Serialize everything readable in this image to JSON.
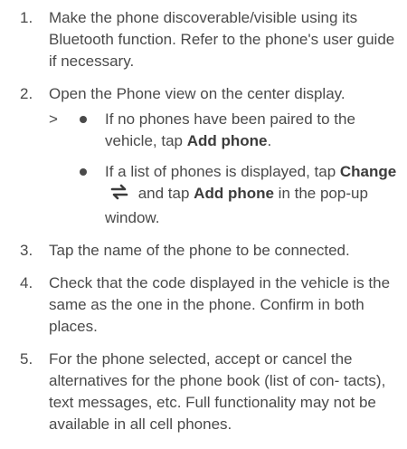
{
  "steps": [
    {
      "number": "1.",
      "text": "Make the phone discoverable/visible using its Bluetooth function. Refer to the phone's user guide if necessary."
    },
    {
      "number": "2.",
      "text": "Open the Phone view on the center display.",
      "result_marker": ">",
      "bullets": [
        {
          "pre": "If no phones have been paired to the vehicle, tap ",
          "bold": "Add phone",
          "post": "."
        },
        {
          "pre": "If a list of phones is displayed, tap ",
          "bold1": "Change",
          "icon": "change-arrows-icon",
          "mid": " and tap ",
          "bold2": "Add phone",
          "post": " in the pop-up window."
        }
      ]
    },
    {
      "number": "3.",
      "text": "Tap the name of the phone to be connected."
    },
    {
      "number": "4.",
      "text": "Check that the code displayed in the vehicle is the same as the one in the phone. Confirm in both places."
    },
    {
      "number": "5.",
      "text": "For the phone selected, accept or cancel the alternatives for the phone book (list of con- tacts), text messages, etc. Full functionality may not be available in all cell phones."
    }
  ]
}
